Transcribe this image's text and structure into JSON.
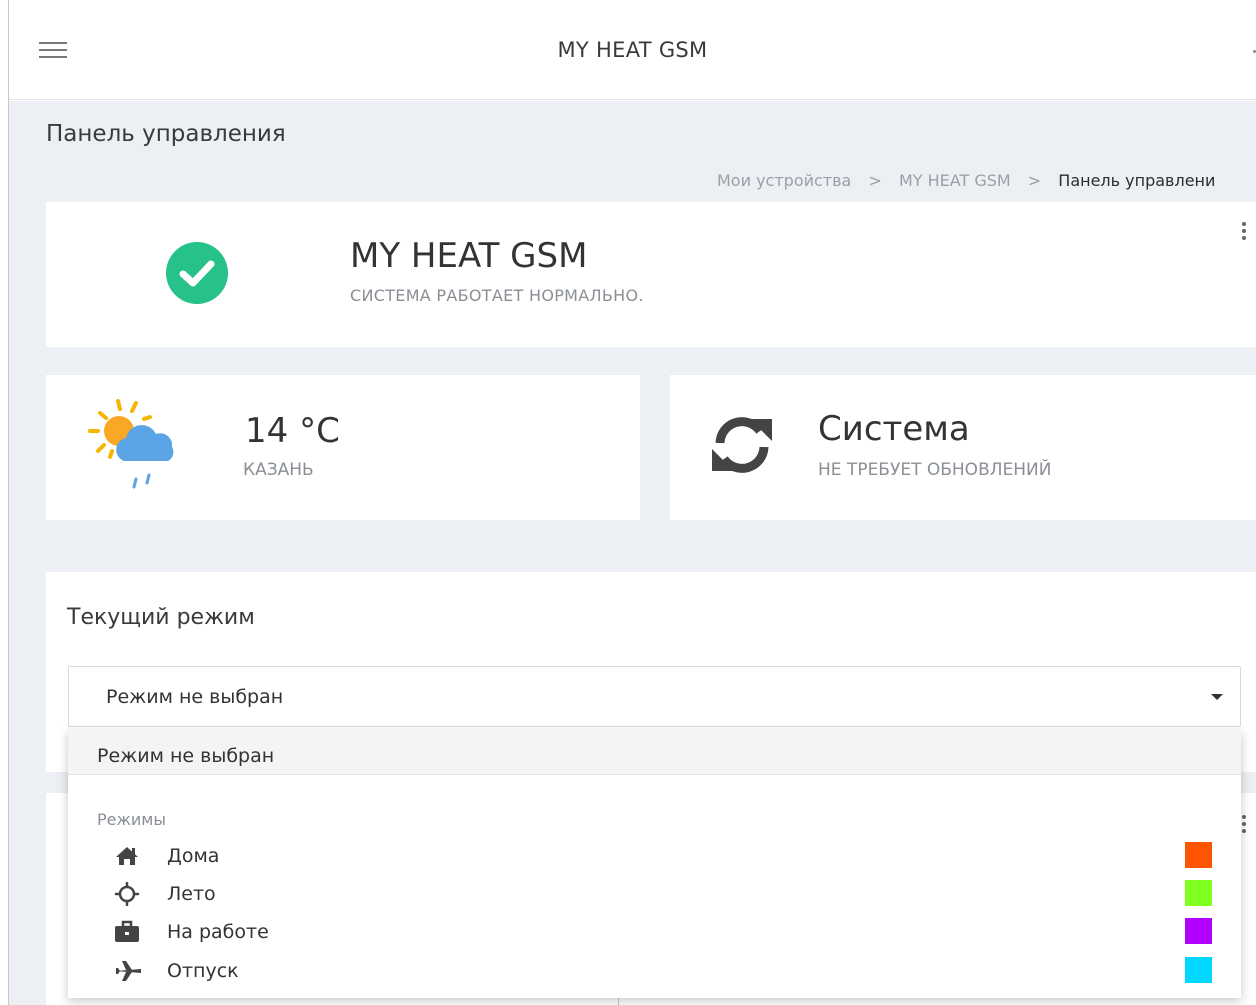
{
  "app_bar": {
    "title": "MY HEAT GSM"
  },
  "page": {
    "title": "Панель управления"
  },
  "breadcrumb": {
    "items": [
      "Мои устройства",
      "MY HEAT GSM",
      "Панель управлени"
    ],
    "separator": ">"
  },
  "status": {
    "name": "MY HEAT GSM",
    "message": "СИСТЕМА РАБОТАЕТ НОРМАЛЬНО.",
    "icon": "check-circle-icon",
    "color": "#26c28a"
  },
  "weather": {
    "temperature": "14 °C",
    "city": "КАЗАНЬ",
    "icon": "sun-cloud-rain-icon"
  },
  "system": {
    "title": "Система",
    "message": "НЕ ТРЕБУЕТ ОБНОВЛЕНИЙ",
    "icon": "sync-icon"
  },
  "mode": {
    "label": "Текущий режим",
    "selected": "Режим не выбран"
  },
  "dropdown": {
    "selected_option": "Режим не выбран",
    "group_label": "Режимы",
    "options": [
      {
        "label": "Дома",
        "icon": "home-icon",
        "color": "#ff5500"
      },
      {
        "label": "Лето",
        "icon": "sun-outline-icon",
        "color": "#7fff1e"
      },
      {
        "label": "На работе",
        "icon": "briefcase-icon",
        "color": "#b400ff"
      },
      {
        "label": "Отпуск",
        "icon": "airplane-icon",
        "color": "#00d8ff"
      }
    ]
  }
}
